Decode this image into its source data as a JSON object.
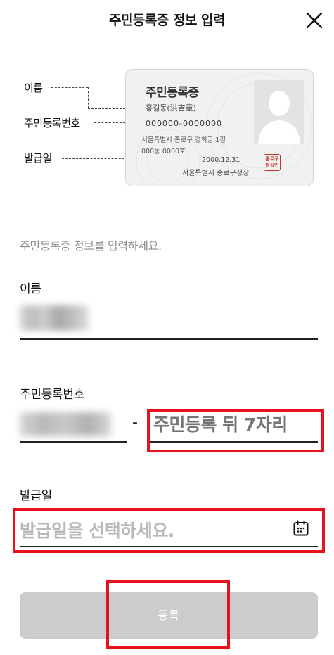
{
  "header": {
    "title": "주민등록증 정보 입력",
    "close_icon": "close-icon"
  },
  "diagram": {
    "labels": {
      "name": "이름",
      "rrn": "주민등록번호",
      "issue_date": "발급일"
    },
    "card": {
      "title": "주민등록증",
      "holder_name": "홍길동(洪吉童)",
      "rrn": "000000-0000000",
      "address_line1": "서울특별시 종로구 경희궁 1길",
      "address_line2": "000동 0000호",
      "issue_date": "2000.12.31",
      "issuer": "서울특별시 종로구청장",
      "seal": "종로구청장인",
      "photo_icon": "person-silhouette-icon"
    }
  },
  "instruction": "주민등록증 정보를 입력하세요.",
  "form": {
    "name_label": "이름",
    "rrn_label": "주민등록번호",
    "rrn_separator": "-",
    "rrn_back_placeholder": "주민등록 뒤 7자리",
    "issue_label": "발급일",
    "issue_placeholder": "발급일을 선택하세요.",
    "calendar_icon": "calendar-icon"
  },
  "submit_label": "등록",
  "colors": {
    "highlight": "#e8101a",
    "placeholder": "#b9b9b9",
    "button_disabled": "#cccccc",
    "hint": "#8e8e8e"
  }
}
